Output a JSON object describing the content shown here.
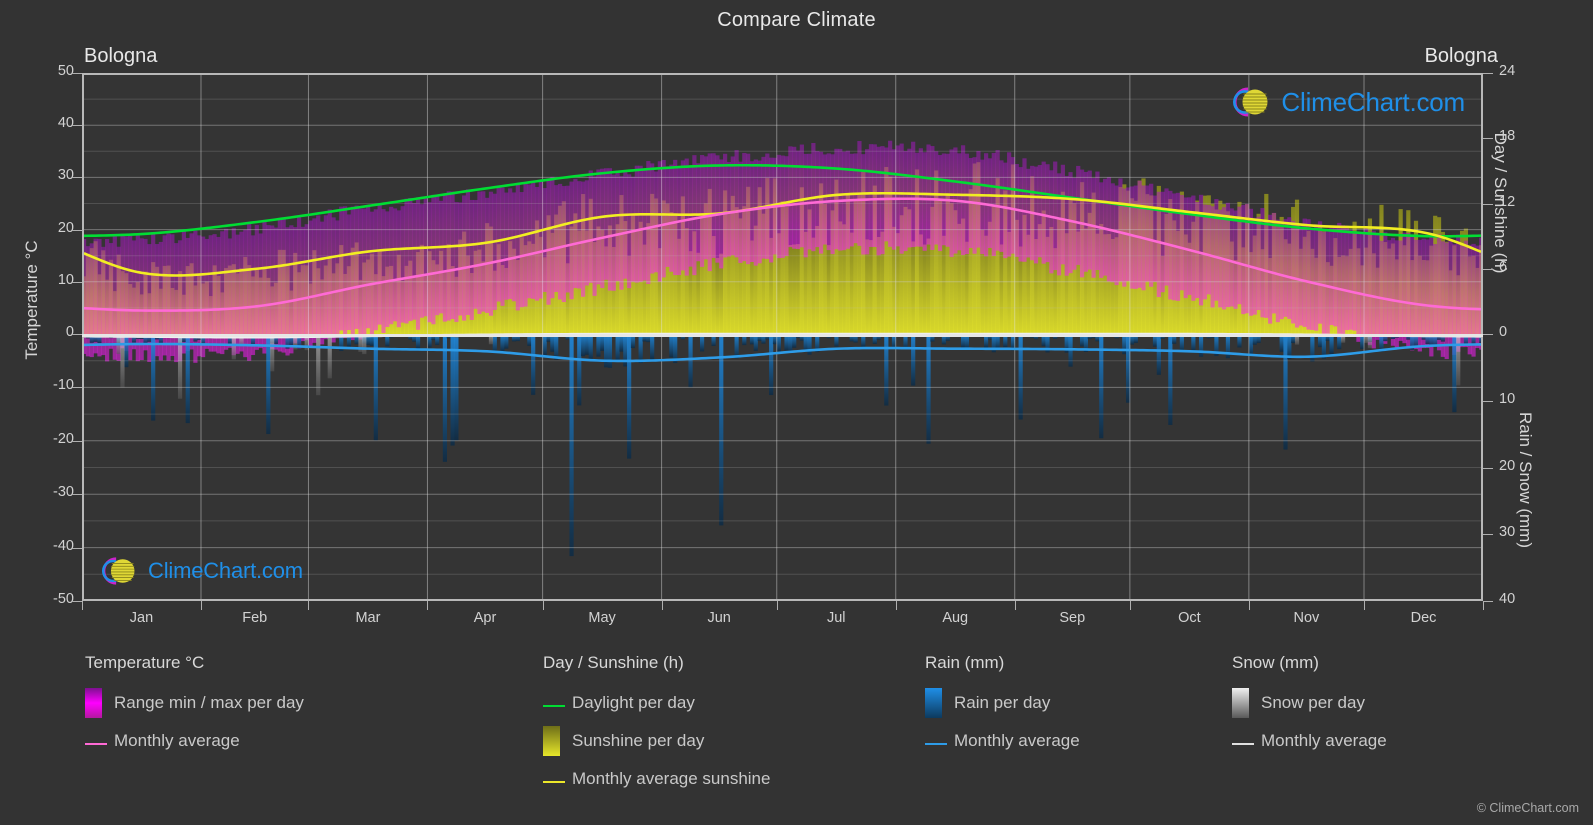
{
  "header": {
    "title": "Compare Climate",
    "location_left": "Bologna",
    "location_right": "Bologna"
  },
  "axes": {
    "left_title": "Temperature °C",
    "right_title_top": "Day / Sunshine (h)",
    "right_title_bottom": "Rain / Snow (mm)",
    "left_ticks": [
      "50",
      "40",
      "30",
      "20",
      "10",
      "0",
      "-10",
      "-20",
      "-30",
      "-40",
      "-50"
    ],
    "right_ticks_top": [
      "24",
      "18",
      "12",
      "6",
      "0"
    ],
    "right_ticks_bottom": [
      "10",
      "20",
      "30",
      "40"
    ],
    "x_ticks": [
      "Jan",
      "Feb",
      "Mar",
      "Apr",
      "May",
      "Jun",
      "Jul",
      "Aug",
      "Sep",
      "Oct",
      "Nov",
      "Dec"
    ]
  },
  "legend": {
    "temperature": {
      "heading": "Temperature °C",
      "items": [
        {
          "label": "Range min / max per day",
          "marker": "gradient-box",
          "color": "#ff00ff"
        },
        {
          "label": "Monthly average",
          "marker": "line",
          "color": "#ff6ad5"
        }
      ]
    },
    "sunshine": {
      "heading": "Day / Sunshine (h)",
      "items": [
        {
          "label": "Daylight per day",
          "marker": "line",
          "color": "#00dd33"
        },
        {
          "label": "Sunshine per day",
          "marker": "gradient-box",
          "color": "#e8e82a"
        },
        {
          "label": "Monthly average sunshine",
          "marker": "line",
          "color": "#ece72a"
        }
      ]
    },
    "rain": {
      "heading": "Rain (mm)",
      "items": [
        {
          "label": "Rain per day",
          "marker": "gradient-box",
          "color": "#1f8fe8"
        },
        {
          "label": "Monthly average",
          "marker": "line",
          "color": "#2e9ce8"
        }
      ]
    },
    "snow": {
      "heading": "Snow (mm)",
      "items": [
        {
          "label": "Snow per day",
          "marker": "gradient-box",
          "color": "#e8e8e8"
        },
        {
          "label": "Monthly average",
          "marker": "line",
          "color": "#e8e8e8"
        }
      ]
    }
  },
  "watermark": {
    "brand": "ClimeChart.com",
    "copyright": "© ClimeChart.com"
  },
  "chart_data": {
    "type": "area",
    "title": "Compare Climate",
    "subtitle": "Bologna",
    "xlabel": "",
    "ylabel": "Temperature °C",
    "ylabel_right_top": "Day / Sunshine (h)",
    "ylabel_right_bottom": "Rain / Snow (mm)",
    "ylim": [
      -50,
      50
    ],
    "ylim_right_top": [
      0,
      24
    ],
    "ylim_right_bottom": [
      0,
      40
    ],
    "grid": true,
    "legend_position": "below",
    "categories": [
      "Jan",
      "Feb",
      "Mar",
      "Apr",
      "May",
      "Jun",
      "Jul",
      "Aug",
      "Sep",
      "Oct",
      "Nov",
      "Dec"
    ],
    "series": [
      {
        "name": "Monthly average temperature",
        "unit": "°C",
        "color": "#ff6ad5",
        "axis": "left",
        "values": [
          4.5,
          5.3,
          9.5,
          13.5,
          18.5,
          23.0,
          25.5,
          25.5,
          21.5,
          16.0,
          10.0,
          5.5
        ]
      },
      {
        "name": "Daily max temperature (range top)",
        "unit": "°C",
        "color": "#aa00cc",
        "axis": "left",
        "values": [
          18.0,
          20.0,
          24.0,
          27.0,
          30.5,
          33.5,
          35.5,
          35.0,
          31.0,
          26.0,
          21.0,
          18.0
        ]
      },
      {
        "name": "Daily min temperature (range bottom)",
        "unit": "°C",
        "color": "#ff00ff",
        "axis": "left",
        "values": [
          -4.0,
          -3.5,
          0.5,
          4.5,
          9.0,
          13.5,
          16.0,
          16.0,
          12.0,
          7.0,
          1.5,
          -3.0
        ]
      },
      {
        "name": "Daylight per day",
        "unit": "h",
        "color": "#00dd33",
        "axis": "right-top",
        "values": [
          9.2,
          10.3,
          11.8,
          13.4,
          14.8,
          15.5,
          15.2,
          14.0,
          12.5,
          11.0,
          9.7,
          9.0
        ]
      },
      {
        "name": "Monthly average sunshine",
        "unit": "h",
        "color": "#ece72a",
        "axis": "right-top",
        "values": [
          5.6,
          6.0,
          7.6,
          8.4,
          10.8,
          11.1,
          12.8,
          12.8,
          12.4,
          11.2,
          10.0,
          9.3
        ]
      },
      {
        "name": "Monthly average rain",
        "unit": "mm",
        "color": "#2e9ce8",
        "axis": "right-bottom",
        "values": [
          1.5,
          1.7,
          2.2,
          2.6,
          4.0,
          3.5,
          2.2,
          2.2,
          2.3,
          2.6,
          3.4,
          1.8
        ]
      },
      {
        "name": "Monthly average snow",
        "unit": "mm",
        "color": "#e8e8e8",
        "axis": "right-bottom",
        "values": [
          0.4,
          0.5,
          0.3,
          0.1,
          0.0,
          0.0,
          0.0,
          0.0,
          0.0,
          0.0,
          0.1,
          0.3
        ]
      }
    ]
  }
}
